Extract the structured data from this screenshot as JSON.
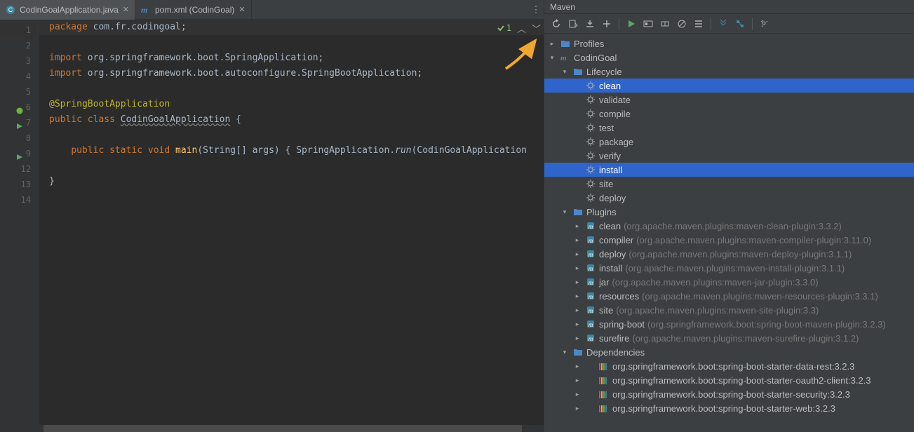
{
  "tabs": [
    {
      "label": "CodinGoalApplication.java",
      "icon": "class-icon",
      "active": true
    },
    {
      "label": "pom.xml (CodinGoal)",
      "icon": "maven-m-icon",
      "active": false
    }
  ],
  "editor_status": {
    "annotations": "1"
  },
  "gutter_lines": [
    "1",
    "2",
    "3",
    "4",
    "5",
    "6",
    "7",
    "8",
    "9",
    "12",
    "13",
    "14"
  ],
  "code": {
    "l1": {
      "kw": "package ",
      "pkg": "com.fr.codingoal",
      "end": ";"
    },
    "l3": {
      "kw": "import ",
      "pkg": "org.springframework.boot.SpringApplication",
      "end": ";"
    },
    "l4": {
      "kw": "import ",
      "pkg": "org.springframework.boot.autoconfigure.SpringBootApplication",
      "end": ";"
    },
    "l6": {
      "ann": "@SpringBootApplication"
    },
    "l7": {
      "kw1": "public class ",
      "cls": "CodinGoalApplication",
      "tail": " {"
    },
    "l9": {
      "indent": "    ",
      "kw": "public static void ",
      "mth": "main",
      "args": "(String[] args) ",
      "brace": "{ ",
      "call1": "SpringApplication.",
      "call2": "run",
      "tail": "(CodinGoalApplication"
    },
    "l13": {
      "brace": "}"
    }
  },
  "maven": {
    "title": "Maven",
    "tree": {
      "profiles": "Profiles",
      "project": "CodinGoal",
      "lifecycle": "Lifecycle",
      "lifecycle_items": [
        "clean",
        "validate",
        "compile",
        "test",
        "package",
        "verify",
        "install",
        "site",
        "deploy"
      ],
      "lifecycle_selected": [
        "clean",
        "install"
      ],
      "plugins": "Plugins",
      "plugins_items": [
        {
          "name": "clean",
          "desc": "(org.apache.maven.plugins:maven-clean-plugin:3.3.2)"
        },
        {
          "name": "compiler",
          "desc": "(org.apache.maven.plugins:maven-compiler-plugin:3.11.0)"
        },
        {
          "name": "deploy",
          "desc": "(org.apache.maven.plugins:maven-deploy-plugin:3.1.1)"
        },
        {
          "name": "install",
          "desc": "(org.apache.maven.plugins:maven-install-plugin:3.1.1)"
        },
        {
          "name": "jar",
          "desc": "(org.apache.maven.plugins:maven-jar-plugin:3.3.0)"
        },
        {
          "name": "resources",
          "desc": "(org.apache.maven.plugins:maven-resources-plugin:3.3.1)"
        },
        {
          "name": "site",
          "desc": "(org.apache.maven.plugins:maven-site-plugin:3.3)"
        },
        {
          "name": "spring-boot",
          "desc": "(org.springframework.boot:spring-boot-maven-plugin:3.2.3)"
        },
        {
          "name": "surefire",
          "desc": "(org.apache.maven.plugins:maven-surefire-plugin:3.1.2)"
        }
      ],
      "dependencies": "Dependencies",
      "deps": [
        "org.springframework.boot:spring-boot-starter-data-rest:3.2.3",
        "org.springframework.boot:spring-boot-starter-oauth2-client:3.2.3",
        "org.springframework.boot:spring-boot-starter-security:3.2.3",
        "org.springframework.boot:spring-boot-starter-web:3.2.3"
      ]
    }
  },
  "colors": {
    "sel": "#2f65ca",
    "run": "#59a869",
    "arrow": "#f0a732"
  }
}
